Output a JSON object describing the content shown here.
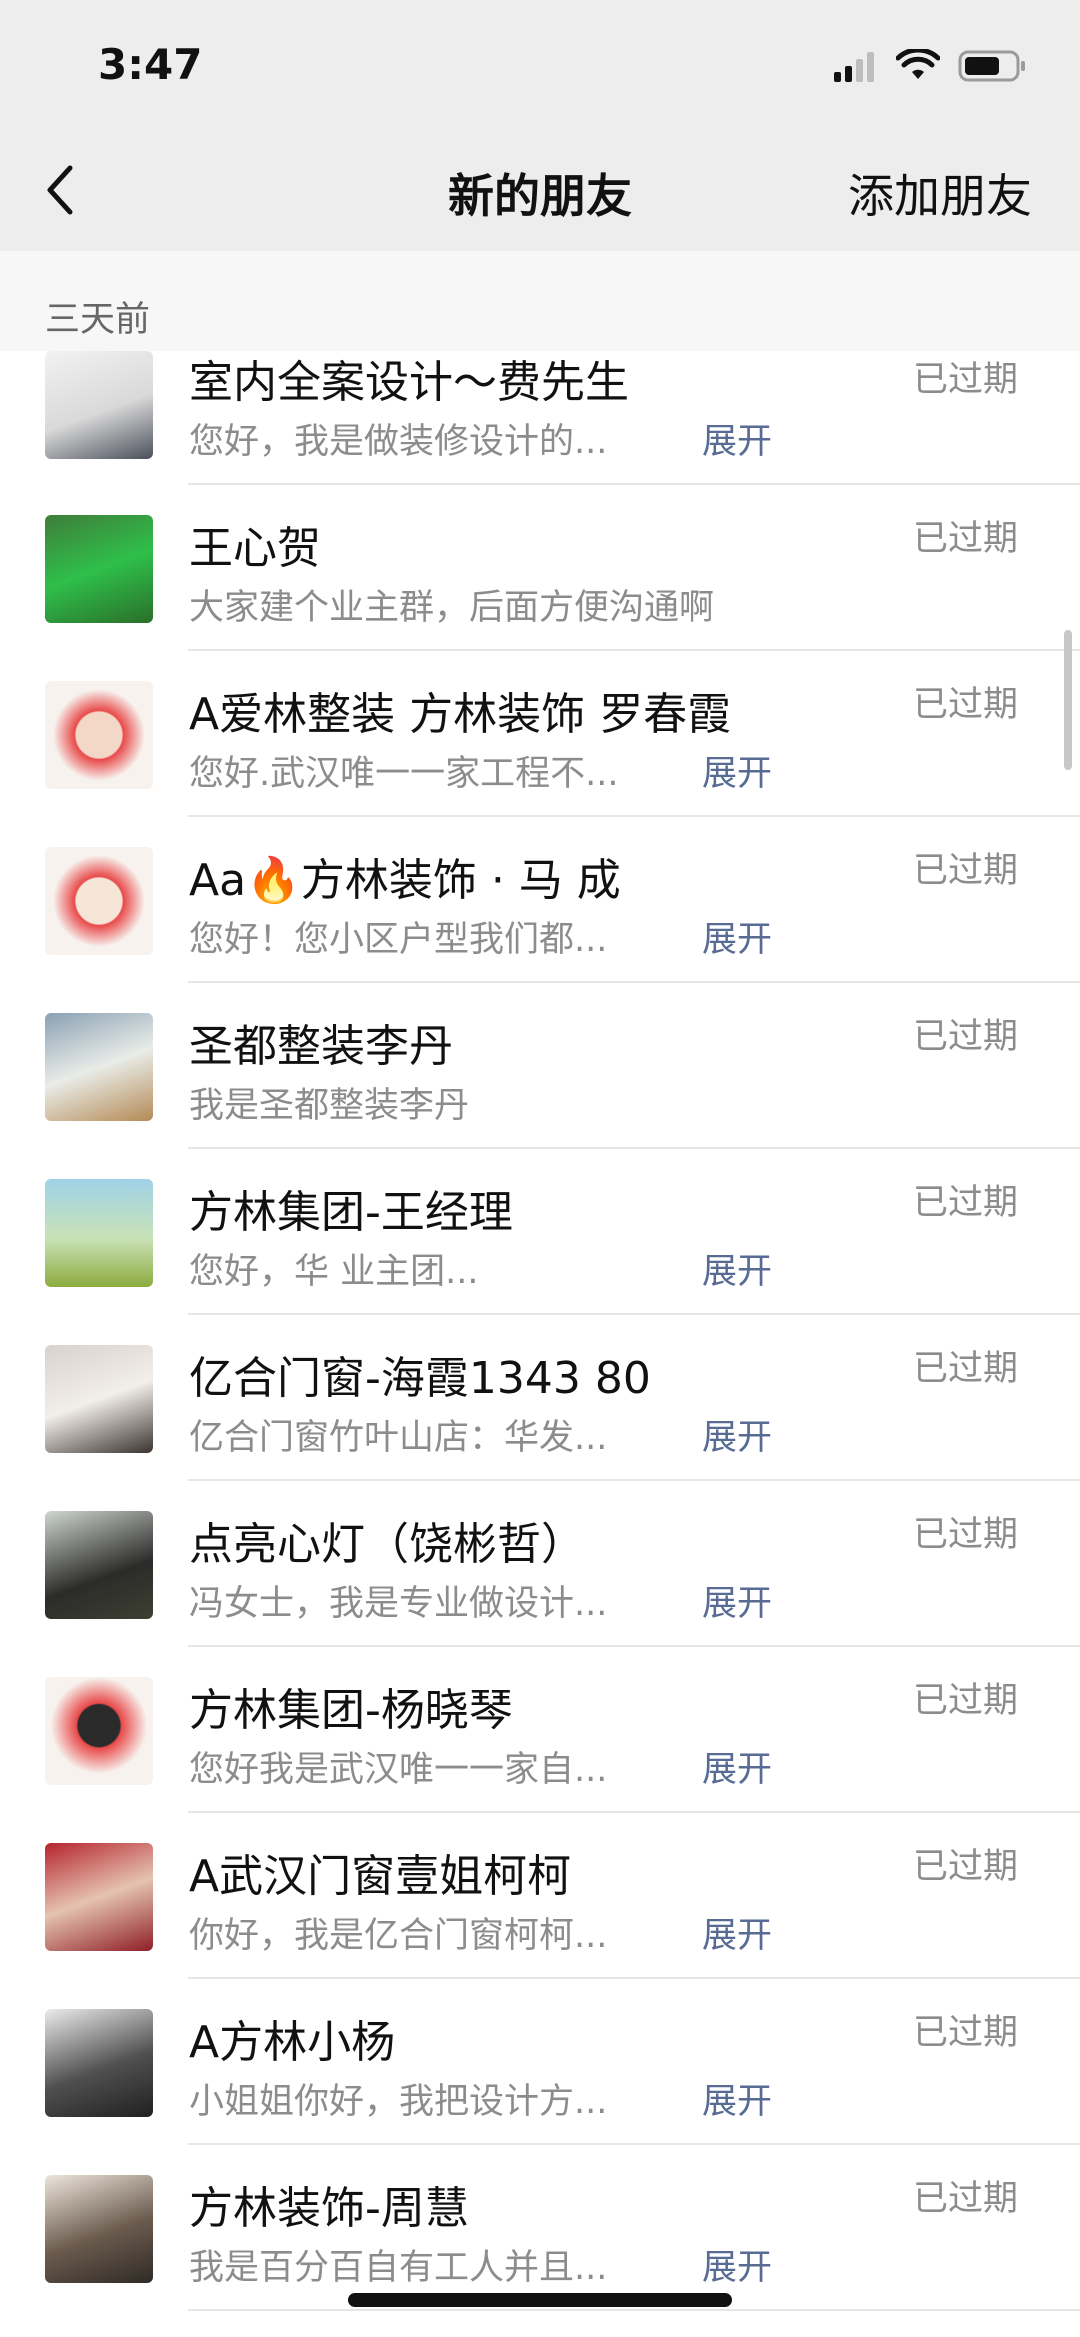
{
  "status_bar": {
    "time": "3:47"
  },
  "nav": {
    "title": "新的朋友",
    "action": "添加朋友"
  },
  "section": {
    "label": "三天前"
  },
  "colors": {
    "link": "#576b95",
    "secondary_text": "#8c8c8c",
    "nav_background": "#ededed"
  },
  "requests": [
    {
      "name": "室内全案设计～费先生",
      "message": "您好，我是做装修设计的...",
      "expand": "展开",
      "status": "已过期",
      "avatar": "avatar-1"
    },
    {
      "name": "王心贺",
      "message": "大家建个业主群，后面方便沟通啊",
      "expand": "",
      "status": "已过期",
      "avatar": "avatar-2"
    },
    {
      "name": "A爱林整装  方林装饰 罗春霞",
      "message": "您好.武汉唯一一家工程不...",
      "expand": "展开",
      "status": "已过期",
      "avatar": "avatar-3"
    },
    {
      "name": "Aa🔥方林装饰 · 马 成",
      "message": "您好！您小区户型我们都...",
      "expand": "展开",
      "status": "已过期",
      "avatar": "avatar-4"
    },
    {
      "name": "圣都整装李丹",
      "message": "我是圣都整装李丹",
      "expand": "",
      "status": "已过期",
      "avatar": "avatar-5"
    },
    {
      "name": "方林集团-王经理",
      "message": "您好，华       业主团...",
      "expand": "展开",
      "status": "已过期",
      "avatar": "avatar-6"
    },
    {
      "name": "亿合门窗-海霞1343     80",
      "message": "亿合门窗竹叶山店：华发...",
      "expand": "展开",
      "status": "已过期",
      "avatar": "avatar-7"
    },
    {
      "name": "点亮心灯（饶彬哲）",
      "message": "冯女士，我是专业做设计...",
      "expand": "展开",
      "status": "已过期",
      "avatar": "avatar-8"
    },
    {
      "name": "方林集团-杨晓琴",
      "message": "您好我是武汉唯一一家自...",
      "expand": "展开",
      "status": "已过期",
      "avatar": "avatar-9"
    },
    {
      "name": "A武汉门窗壹姐柯柯",
      "message": "你好，我是亿合门窗柯柯...",
      "expand": "展开",
      "status": "已过期",
      "avatar": "avatar-10"
    },
    {
      "name": "A方林小杨",
      "message": "小姐姐你好，我把设计方...",
      "expand": "展开",
      "status": "已过期",
      "avatar": "avatar-11"
    },
    {
      "name": "方林装饰-周慧",
      "message": "我是百分百自有工人并且...",
      "expand": "展开",
      "status": "已过期",
      "avatar": "avatar-12"
    }
  ]
}
